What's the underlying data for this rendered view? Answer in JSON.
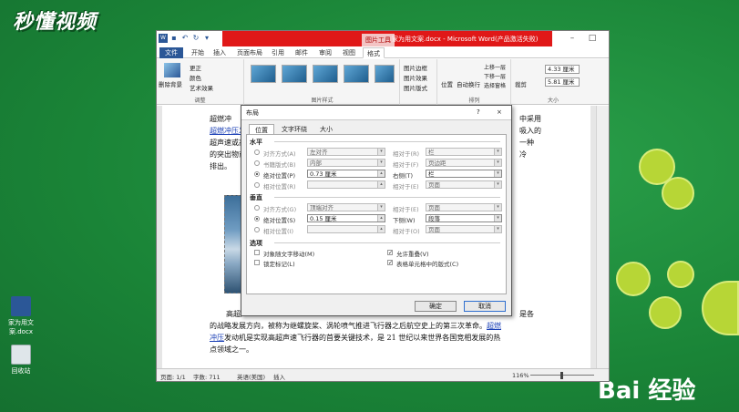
{
  "watermark": {
    "logo_text": "秒懂视频"
  },
  "desktop": {
    "icons": [
      {
        "label": "家为用文案.docx"
      },
      {
        "label": "回收站"
      }
    ],
    "baidu": "Bai  经验"
  },
  "word": {
    "title": "家为用文案.docx - Microsoft Word(产品激活失败)",
    "context_tab": "图片工具",
    "tabs": [
      "文件",
      "开始",
      "插入",
      "页面布局",
      "引用",
      "邮件",
      "审阅",
      "视图",
      "格式"
    ],
    "active_tab": "格式",
    "ribbon": {
      "remove_bg": "删除背景",
      "correct": "更正",
      "color": "颜色",
      "art_effects": "艺术效果",
      "adjust_group": "调整",
      "pic_styles_group": "图片样式",
      "pic_border": "图片边框",
      "pic_effects": "图片效果",
      "pic_layout": "图片版式",
      "position": "位置",
      "wrap_text": "自动换行",
      "bring_forward": "上移一层",
      "send_backward": "下移一层",
      "selection_pane": "选择窗格",
      "arrange_group": "排列",
      "crop": "裁剪",
      "height": "4.33 厘米",
      "width": "5.81 厘米",
      "size_group": "大小"
    },
    "doc": {
      "line1a": "超燃冲",
      "line1b": "中采用",
      "line2a": "超燃冲压发",
      "line2b": "吸入的",
      "line3a": "超声速或高",
      "line3b": "一种",
      "line4a": "的突出物或",
      "line4b": "冷",
      "line5": "排出。",
      "para2_1a": "高超声",
      "para2_1b": "是各",
      "para2_2": "的战略发展方向，被称为继螺旋桨、涡轮喷气推进飞行器之后航空史上的第三次革命。",
      "para2_2link": "超燃",
      "para2_3link": "冲压",
      "para2_3": "发动机是实现高超声速飞行器的首要关键技术，是 21 世纪以来世界各国竞相发展的热",
      "para2_4": "点领域之一。"
    },
    "status": {
      "page": "页面: 1/1",
      "words": "字数: 711",
      "lang": "英语(美国)",
      "mode": "插入",
      "zoom": "116%"
    }
  },
  "dialog": {
    "title": "布局",
    "help": "?",
    "close": "×",
    "tabs": [
      "位置",
      "文字环绕",
      "大小"
    ],
    "active_tab": "位置",
    "horizontal": {
      "header": "水平",
      "rows": [
        {
          "label": "对齐方式(A)",
          "value": "左对齐",
          "rel_label": "相对于(R)",
          "rel_value": "栏",
          "checked": false
        },
        {
          "label": "书籍版式(B)",
          "value": "内部",
          "rel_label": "相对于(F)",
          "rel_value": "页边距",
          "checked": false
        },
        {
          "label": "绝对位置(P)",
          "value": "0.73 厘米",
          "rel_label": "右侧(T)",
          "rel_value": "栏",
          "checked": true
        },
        {
          "label": "相对位置(R)",
          "value": "",
          "rel_label": "相对于(E)",
          "rel_value": "页面",
          "checked": false
        }
      ]
    },
    "vertical": {
      "header": "垂直",
      "rows": [
        {
          "label": "对齐方式(G)",
          "value": "顶端对齐",
          "rel_label": "相对于(E)",
          "rel_value": "页面",
          "checked": false
        },
        {
          "label": "绝对位置(S)",
          "value": "0.15 厘米",
          "rel_label": "下侧(W)",
          "rel_value": "段落",
          "checked": true
        },
        {
          "label": "相对位置(I)",
          "value": "",
          "rel_label": "相对于(O)",
          "rel_value": "页面",
          "checked": false
        }
      ]
    },
    "options": {
      "header": "选项",
      "move_with_text": "对象随文字移动(M)",
      "lock_anchor": "锁定标记(L)",
      "allow_overlap": "允许重叠(V)",
      "layout_in_cell": "表格单元格中的版式(C)"
    },
    "ok": "确定",
    "cancel": "取消"
  }
}
